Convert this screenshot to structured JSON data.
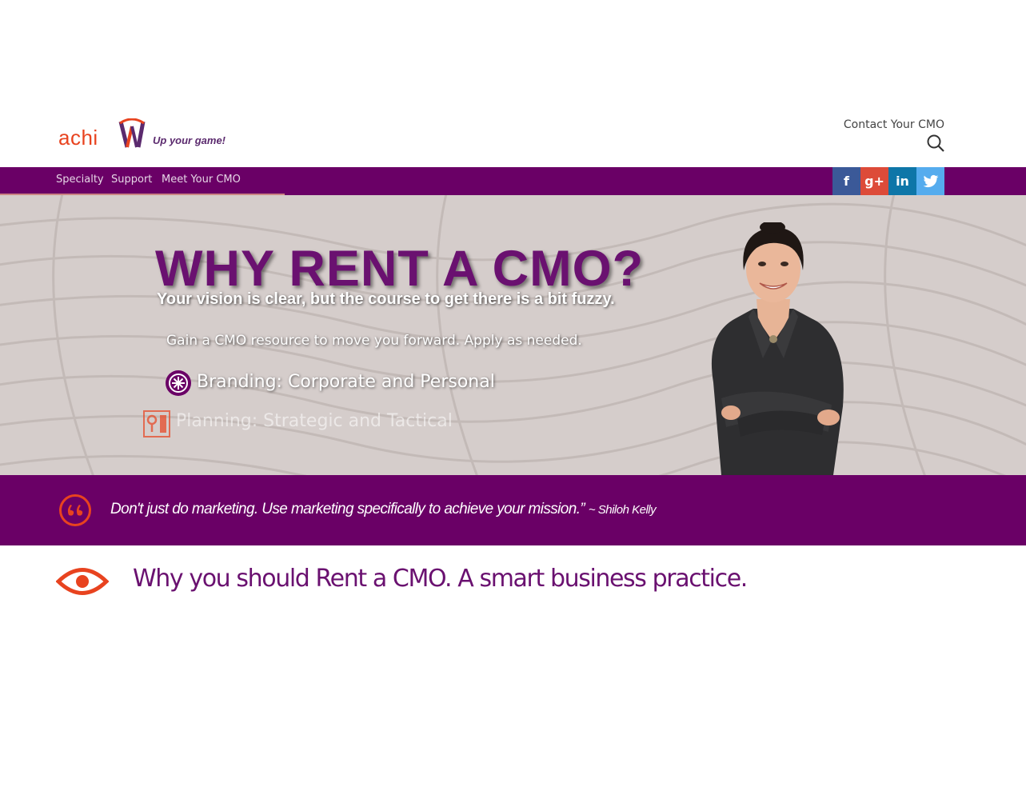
{
  "header": {
    "logo_text": "achi",
    "tagline": "Up your game!",
    "contact_link": "Contact Your CMO"
  },
  "nav": {
    "items": [
      {
        "label": "Specialty"
      },
      {
        "label": "Support"
      },
      {
        "label": "Meet Your CMO"
      }
    ],
    "social": [
      {
        "name": "facebook",
        "glyph": "f",
        "color": "#3b5998"
      },
      {
        "name": "google-plus",
        "glyph": "g+",
        "color": "#dd4b39"
      },
      {
        "name": "linkedin",
        "glyph": "in",
        "color": "#0e76a8"
      },
      {
        "name": "twitter",
        "glyph": "t",
        "color": "#55acee"
      }
    ]
  },
  "hero": {
    "title": "WHY RENT A CMO?",
    "subtitle": "Your vision is clear, but the course to get there is a bit fuzzy.",
    "line": "Gain a CMO resource to move you forward. Apply as needed.",
    "bullet1": "Branding: Corporate and Personal",
    "bullet2": "Planning: Strategic and Tactical"
  },
  "quote": {
    "text": "Don't just do marketing. Use marketing specifically to achieve your mission.”",
    "author": "~ Shiloh Kelly"
  },
  "section": {
    "title": "Why you should Rent a CMO. A smart business practice."
  },
  "colors": {
    "brand_purple": "#6a0066",
    "accent_orange": "#e8431f"
  }
}
